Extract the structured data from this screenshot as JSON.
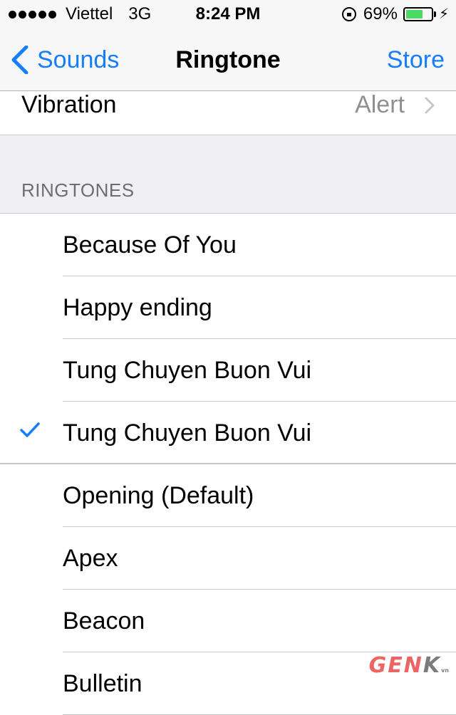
{
  "status_bar": {
    "carrier": "Viettel",
    "network": "3G",
    "time": "8:24 PM",
    "battery_percent_label": "69%",
    "battery_level": 0.69,
    "signal_bars": 5,
    "icons": [
      "signal-dots-icon",
      "orientation-lock-icon",
      "battery-icon",
      "charging-bolt-icon"
    ]
  },
  "nav": {
    "back_label": "Sounds",
    "title": "Ringtone",
    "right_label": "Store"
  },
  "vibration": {
    "label": "Vibration",
    "value": "Alert"
  },
  "section": {
    "header": "RINGTONES"
  },
  "ringtones": [
    {
      "label": "Because Of You",
      "selected": false
    },
    {
      "label": "Happy ending",
      "selected": false
    },
    {
      "label": "Tung Chuyen Buon Vui",
      "selected": false
    },
    {
      "label": "Tung Chuyen Buon Vui",
      "selected": true
    },
    {
      "label": "Opening (Default)",
      "selected": false
    },
    {
      "label": "Apex",
      "selected": false
    },
    {
      "label": "Beacon",
      "selected": false
    },
    {
      "label": "Bulletin",
      "selected": false
    }
  ],
  "watermark": {
    "text_a": "GEN",
    "text_b": "K",
    "suffix": "vn"
  },
  "colors": {
    "accent": "#157efb",
    "battery_fill": "#4cd964",
    "group_background": "#efeff4",
    "secondary_text": "#8e8e93"
  }
}
